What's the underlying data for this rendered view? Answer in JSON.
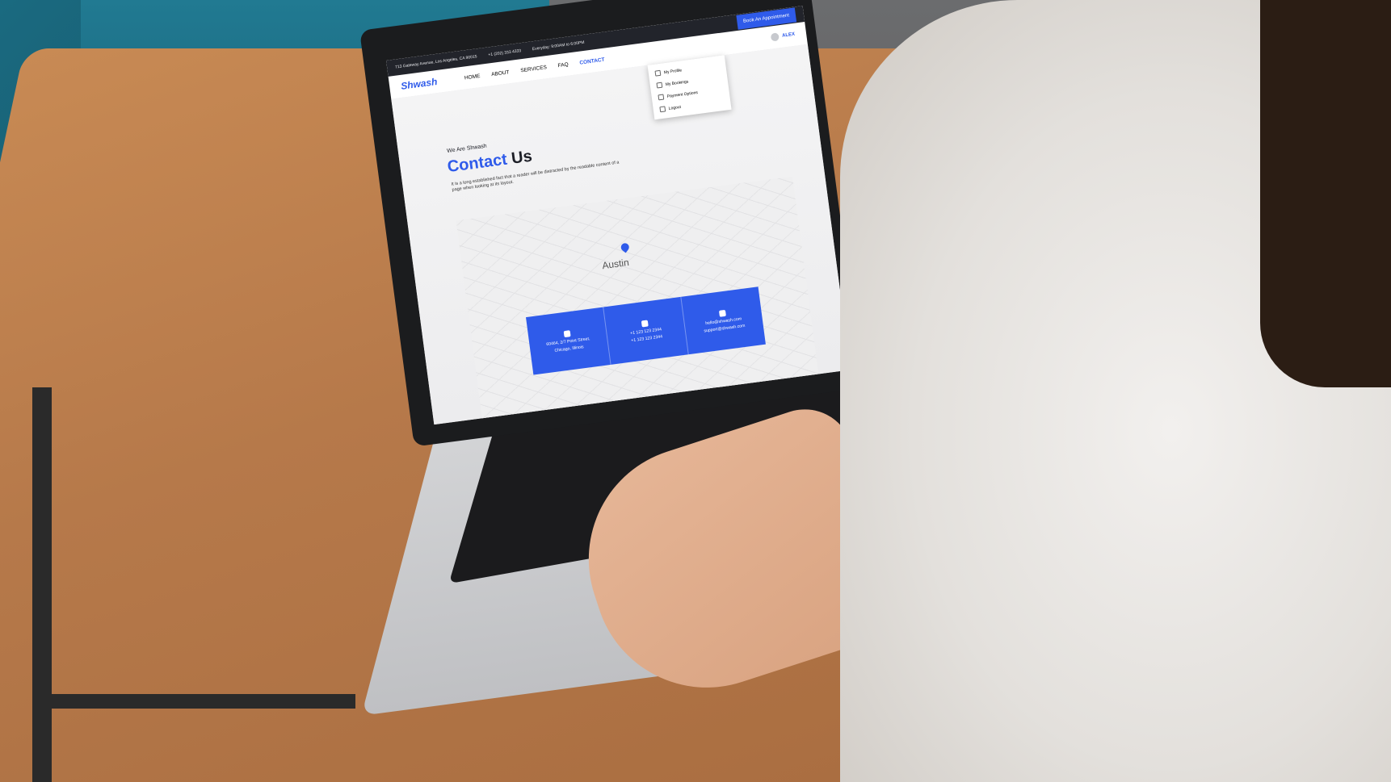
{
  "topbar": {
    "address": "713 Gateway Avenue, Los Angeles, CA 90015",
    "phone": "+1 (202) 333 4333",
    "hours": "Everyday: 9:00AM to 6:00PM",
    "book_label": "Book An Appointment"
  },
  "nav": {
    "logo": "Shwash",
    "items": [
      {
        "label": "HOME"
      },
      {
        "label": "ABOUT"
      },
      {
        "label": "SERVICES"
      },
      {
        "label": "FAQ"
      },
      {
        "label": "CONTACT"
      }
    ],
    "user_name": "ALEX"
  },
  "user_menu": {
    "items": [
      {
        "label": "My Profile"
      },
      {
        "label": "My Bookings"
      },
      {
        "label": "Payment Options"
      },
      {
        "label": "Logout"
      }
    ]
  },
  "hero": {
    "eyebrow": "We Are Shwash",
    "title_highlight": "Contact",
    "title_rest": " Us",
    "description": "It is a long established fact that a reader will be distracted by the readable content of a page when looking at its layout."
  },
  "map": {
    "city_label": "Austin"
  },
  "contact": {
    "address_line1": "60464, 2/7 Point Street,",
    "address_line2": "Chicago, Illinois",
    "phone1": "+1 123 123 2344",
    "phone2": "+1 123 123 2344",
    "email1": "hello@shwash.com",
    "email2": "support@shwash.com"
  }
}
